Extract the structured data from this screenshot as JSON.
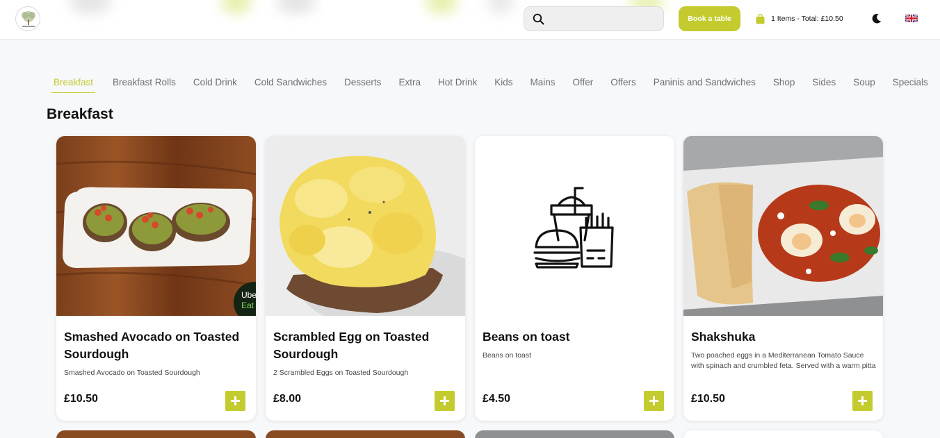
{
  "header": {
    "logo_icon": "restaurant-logo",
    "search": {
      "placeholder": "",
      "icon": "search-icon"
    },
    "book_label": "Book a table",
    "cart_text": "1 Items - Total: £10.50",
    "cart_icon": "shopping-bag-icon",
    "theme_icon": "moon-icon",
    "language_icon": "uk-flag-icon"
  },
  "tabs": [
    {
      "label": "Breakfast",
      "active": true
    },
    {
      "label": "Breakfast Rolls"
    },
    {
      "label": "Cold Drink"
    },
    {
      "label": "Cold Sandwiches"
    },
    {
      "label": "Desserts"
    },
    {
      "label": "Extra"
    },
    {
      "label": "Hot Drink"
    },
    {
      "label": "Kids"
    },
    {
      "label": "Mains"
    },
    {
      "label": "Offer"
    },
    {
      "label": "Offers"
    },
    {
      "label": "Paninis and Sandwiches"
    },
    {
      "label": "Shop"
    },
    {
      "label": "Sides"
    },
    {
      "label": "Soup"
    },
    {
      "label": "Specials"
    }
  ],
  "section_title": "Breakfast",
  "products": [
    {
      "title": "Smashed Avocado on Toasted Sourdough",
      "description": "Smashed Avocado on Toasted Sourdough",
      "price": "£10.50",
      "badge": "Uber Eats",
      "badge_short": "Ube",
      "badge_short2": "Eat"
    },
    {
      "title": "Scrambled Egg on Toasted Sourdough",
      "description": "2 Scrambled Eggs on Toasted Sourdough",
      "price": "£8.00"
    },
    {
      "title": "Beans on toast",
      "description": "Beans on toast",
      "price": "£4.50",
      "image_icon": "fast-food-icon"
    },
    {
      "title": "Shakshuka",
      "description": "Two poached eggs in a Mediterranean Tomato Sauce with spinach and crumbled feta. Served with a warm pitta",
      "price": "£10.50"
    }
  ],
  "colors": {
    "accent": "#c3cb2e",
    "text": "#111111",
    "muted": "#6f6f6f",
    "background": "#f7f8fa"
  }
}
